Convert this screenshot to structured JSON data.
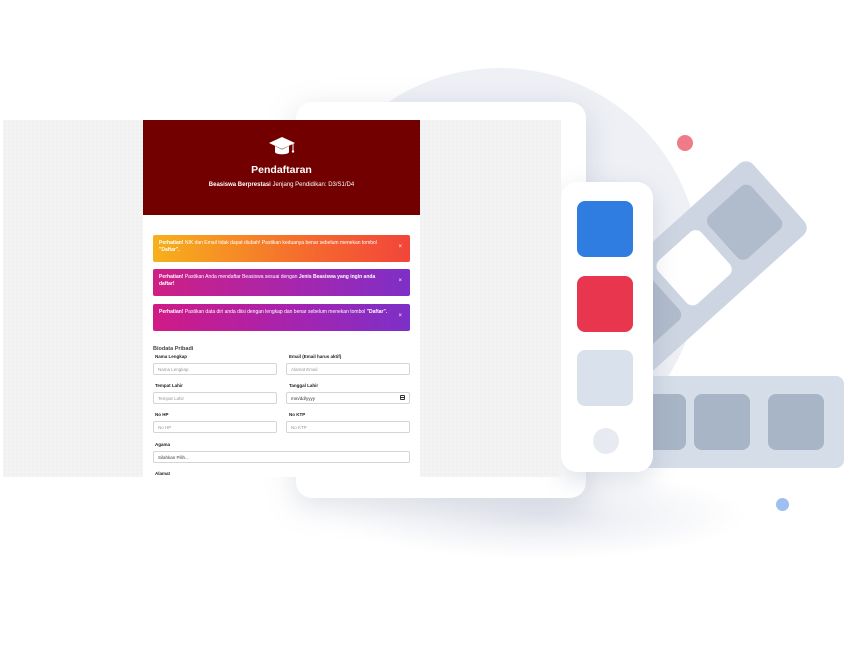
{
  "form": {
    "title": "Pendaftaran",
    "subtitle_bold": "Beasiswa Berprestasi",
    "subtitle_rest": " Jenjang Pendidikan: D3/S1/D4",
    "alerts": [
      {
        "bold": "Perhatian!",
        "text": " NIK dan Email tidak dapat diubah! Pastikan keduanya benar sebelum menekan tombol ",
        "bold2": "\"Daftar\".",
        "close": "×"
      },
      {
        "bold": "Perhatian!",
        "text": " Pastikan Anda mendaftar Beasiswa sesuai dengan ",
        "bold2": "Jenis Beasiswa yang ingin anda daftar!",
        "close": "×"
      },
      {
        "bold": "Perhatian!",
        "text": " Pastikan data diri anda diisi dengan lengkap dan benar sebelum menekan tombol ",
        "bold2": "\"Daftar\".",
        "close": "×"
      }
    ],
    "section_title": "Biodata Pribadi",
    "fields": {
      "nama": {
        "label": "Nama Lengkap",
        "placeholder": "Nama Lengkap"
      },
      "email": {
        "label": "Email (Email harus aktif)",
        "placeholder": "Alamat Email"
      },
      "tempat": {
        "label": "Tempat Lahir",
        "placeholder": "Tempat Lahir"
      },
      "tanggal": {
        "label": "Tanggal Lahir",
        "placeholder": "mm/dd/yyyy"
      },
      "hp": {
        "label": "No HP",
        "placeholder": "No HP"
      },
      "ktp": {
        "label": "No KTP",
        "placeholder": "No KTP"
      },
      "agama": {
        "label": "Agama",
        "value": "Silahkan Pilih..."
      },
      "alamat": {
        "label": "Alamat"
      }
    }
  },
  "colors": {
    "header": "#720000",
    "palette": [
      "#2f7de1",
      "#e8364f",
      "#d9e1ec"
    ]
  }
}
